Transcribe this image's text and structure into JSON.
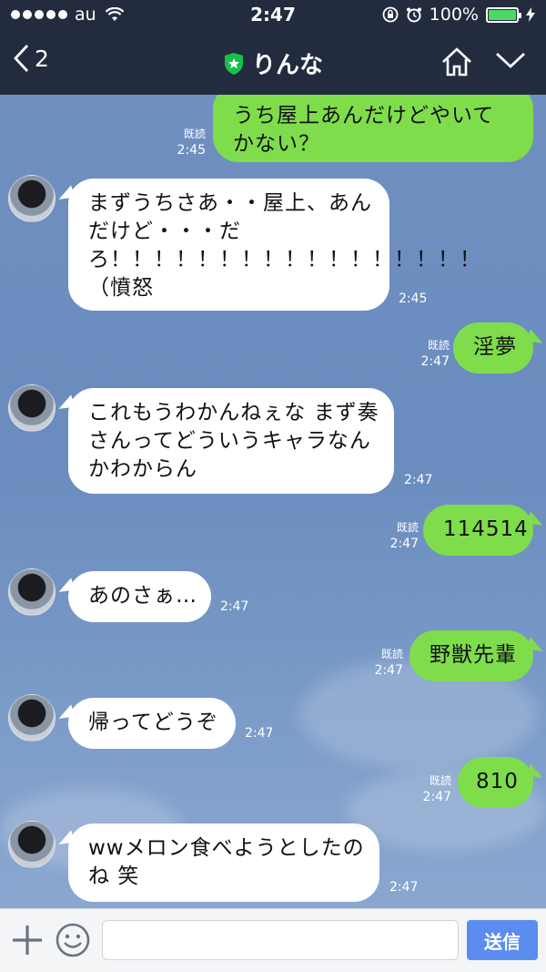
{
  "status": {
    "carrier": "au",
    "time": "2:47",
    "battery": "100%"
  },
  "header": {
    "back_count": "2",
    "title": "りんな"
  },
  "messages": [
    {
      "dir": "out",
      "text": "うち屋上あんだけどやいてかない？",
      "read": "既読",
      "time": "2:45"
    },
    {
      "dir": "in",
      "text": "まずうちさあ・・屋上、あんだけど・・・だろ！！！！！！！！！！！！！！！！！（憤怒",
      "time": "2:45"
    },
    {
      "dir": "out",
      "text": "淫夢",
      "read": "既読",
      "time": "2:47"
    },
    {
      "dir": "in",
      "text": "これもうわかんねぇな まず奏さんってどういうキャラなんかわからん",
      "time": "2:47"
    },
    {
      "dir": "out",
      "text": "114514",
      "read": "既読",
      "time": "2:47"
    },
    {
      "dir": "in",
      "text": "あのさぁ…",
      "time": "2:47"
    },
    {
      "dir": "out",
      "text": "野獣先輩",
      "read": "既読",
      "time": "2:47"
    },
    {
      "dir": "in",
      "text": "帰ってどうぞ",
      "time": "2:47"
    },
    {
      "dir": "out",
      "text": "810",
      "read": "既読",
      "time": "2:47"
    },
    {
      "dir": "in",
      "text": "wwメロン食べようとしたのね 笑",
      "time": "2:47"
    }
  ],
  "input": {
    "value": "",
    "send_label": "送信"
  }
}
